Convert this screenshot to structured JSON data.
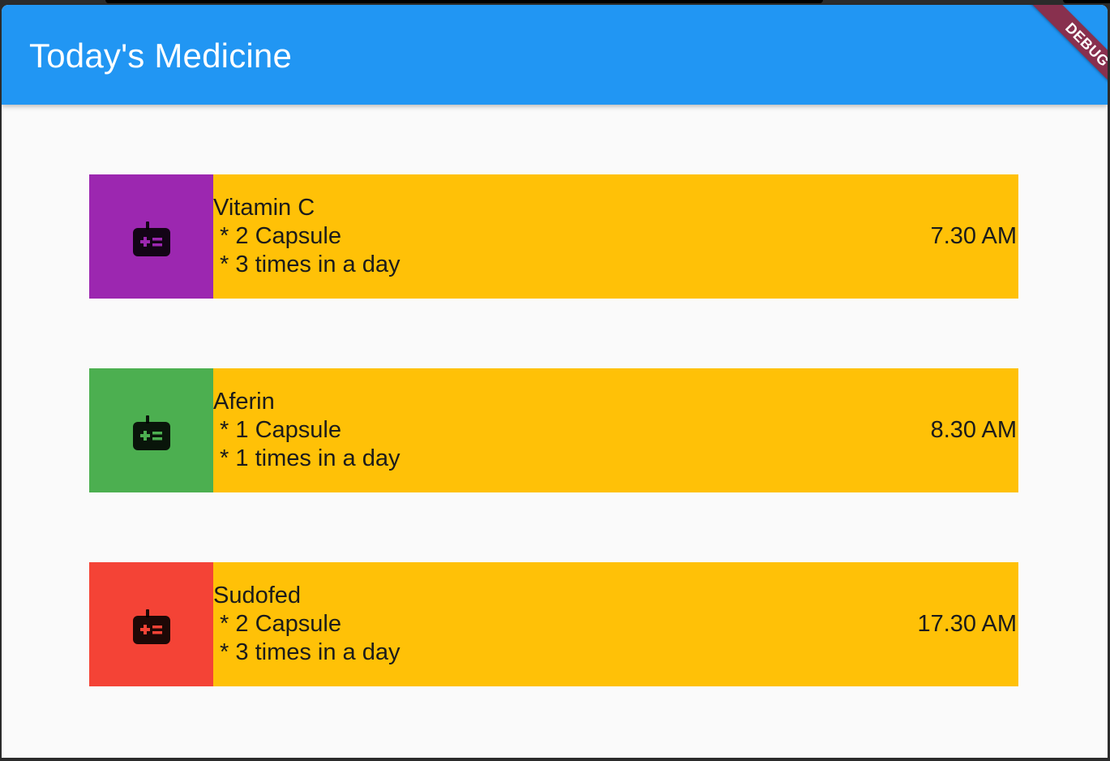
{
  "theme": {
    "app_bar_color": "#2196f3",
    "card_color": "#ffc107",
    "debug_banner_color": "#88304e"
  },
  "app_bar": {
    "title": "Today's Medicine"
  },
  "debug_banner": {
    "label": "DEBUG"
  },
  "medicines": [
    {
      "name": "Vitamin C",
      "dose": " * 2 Capsule",
      "frequency": " * 3 times in a day",
      "time": "7.30 AM",
      "swatch_color": "#9c27b0",
      "icon": "medical-kit-icon"
    },
    {
      "name": "Aferin",
      "dose": " * 1 Capsule",
      "frequency": " * 1 times in a day",
      "time": "8.30 AM",
      "swatch_color": "#4caf50",
      "icon": "medical-kit-icon"
    },
    {
      "name": "Sudofed",
      "dose": " * 2 Capsule",
      "frequency": " * 3 times in a day",
      "time": "17.30 AM",
      "swatch_color": "#f44336",
      "icon": "medical-kit-icon"
    }
  ]
}
